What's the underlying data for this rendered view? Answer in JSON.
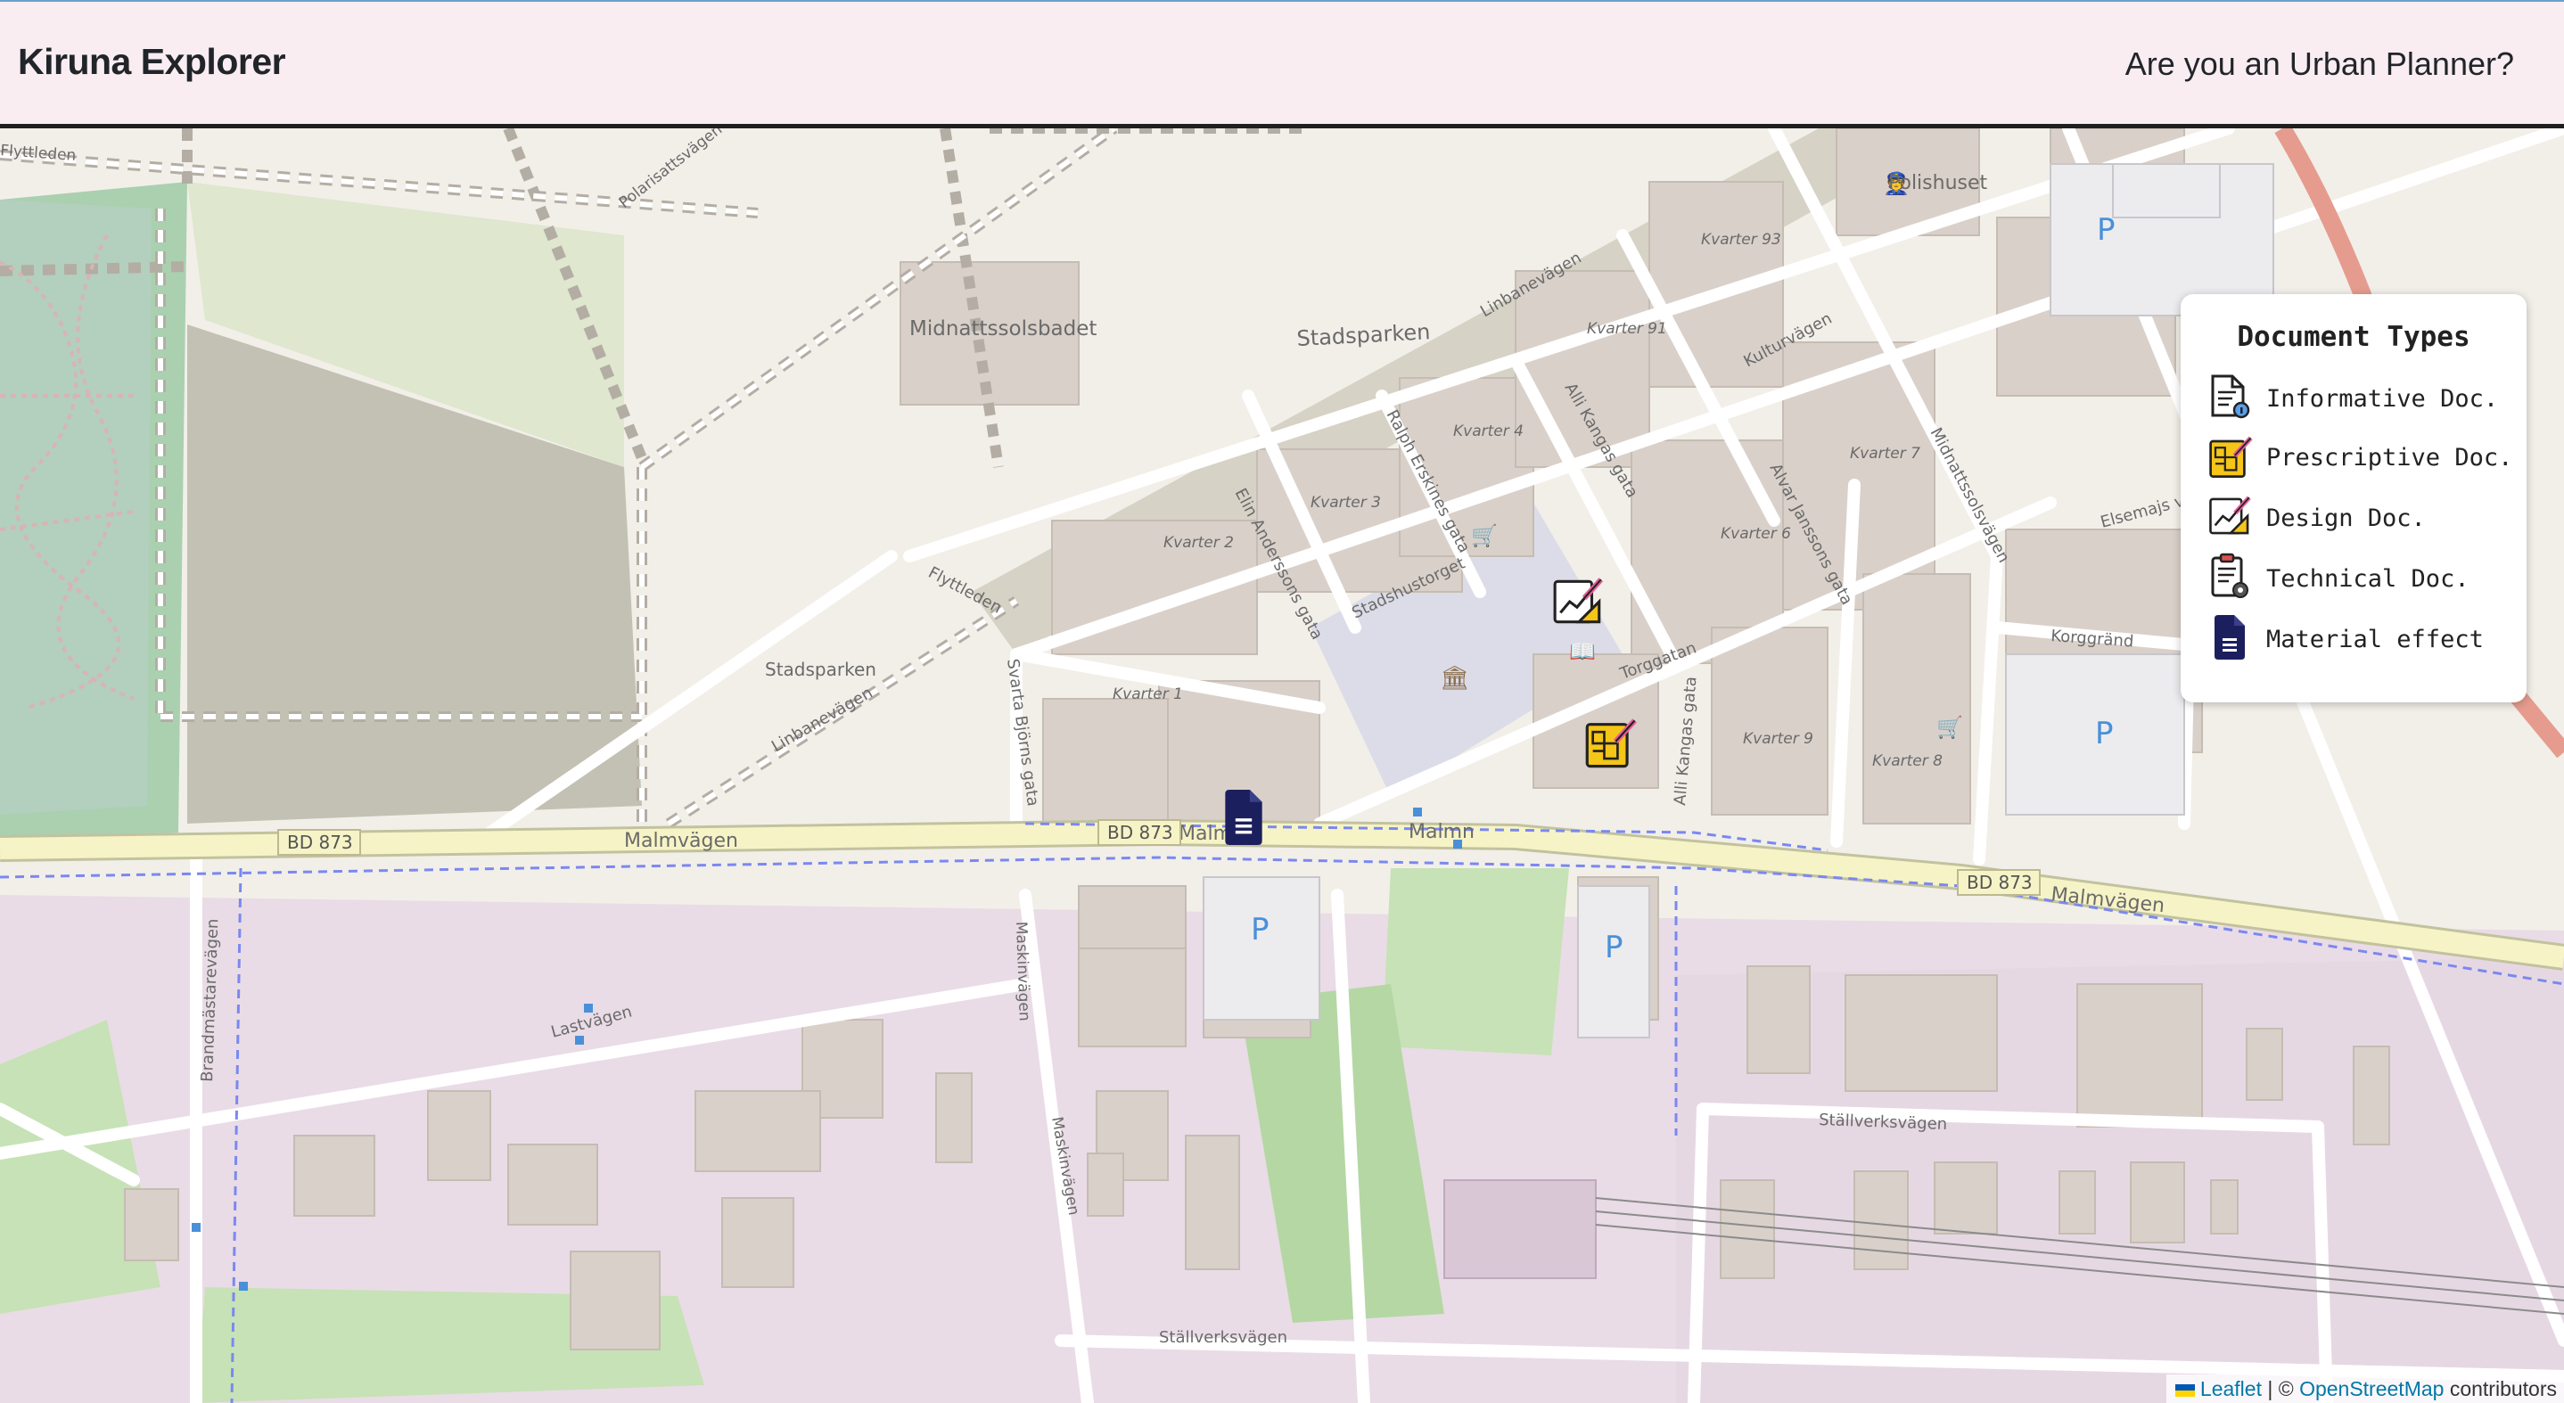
{
  "navbar": {
    "brand": "Kiruna Explorer",
    "planner_link": "Are you an Urban Planner?"
  },
  "legend": {
    "title": "Document Types",
    "items": [
      {
        "label": "Informative Doc.",
        "icon": "informative-doc-icon"
      },
      {
        "label": "Prescriptive Doc.",
        "icon": "prescriptive-doc-icon"
      },
      {
        "label": "Design Doc.",
        "icon": "design-doc-icon"
      },
      {
        "label": "Technical Doc.",
        "icon": "technical-doc-icon"
      },
      {
        "label": "Material effect",
        "icon": "material-effect-icon"
      }
    ]
  },
  "map_labels": {
    "midnattssolsbadet": "Midnattssolsbadet",
    "stadsparken": "Stadsparken",
    "stadsparken2": "Stadsparken",
    "polishuset": "Polishuset",
    "malmvagen": "Malmvägen",
    "malmvagen2": "Malmvägen",
    "malmvagen3": "Malmn",
    "bd873a": "BD 873",
    "bd873b": "BD 873",
    "bd873c": "BD 873",
    "bd873d_malm": "Malm",
    "linbanevagen": "Linbanevägen",
    "linbanevagen2": "Linbanevägen",
    "kulturvagen": "Kulturvägen",
    "torggatan": "Torggatan",
    "stadshustorget": "Stadshustorget",
    "flyttleden": "Flyttleden",
    "flyttleden2": "Flyttleden",
    "polarisattsvagen": "Polarisattsvägen",
    "svarta_bjorns_gata": "Svarta Björns gata",
    "elin_anderssons_gata": "Elin Anderssons gata",
    "ralph_erskines_gata": "Ralph Erskines gata",
    "alli_kangas_gata": "Alli Kangas gata",
    "alli_kangas_gata2": "Alli Kangas gata",
    "alvar_janssons_gata": "Alvar Janssons gata",
    "midnattssolsvagen": "Midnattssolsvägen",
    "elsemajs_vag": "Elsemajs väg",
    "korggrand": "Korggränd",
    "maskinvagen": "Maskinvägen",
    "maskinvagen2": "Maskinvägen",
    "lastvagen": "Lastvägen",
    "brandmastarevagen": "Brandmästarevägen",
    "stallverksvagen": "Ställverksvägen",
    "stallverksvagen2": "Ställverksvägen",
    "kvarter93": "Kvarter 93",
    "kvarter91": "Kvarter 91",
    "kvarter4": "Kvarter 4",
    "kvarter3": "Kvarter 3",
    "kvarter2": "Kvarter 2",
    "kvarter1": "Kvarter 1",
    "kvarter7": "Kvarter 7",
    "kvarter6": "Kvarter 6",
    "kvarter9": "Kvarter 9",
    "kvarter8": "Kvarter 8",
    "parking": "P"
  },
  "attribution": {
    "leaflet": "Leaflet",
    "separator": " | © ",
    "osm": "OpenStreetMap",
    "suffix": " contributors"
  }
}
